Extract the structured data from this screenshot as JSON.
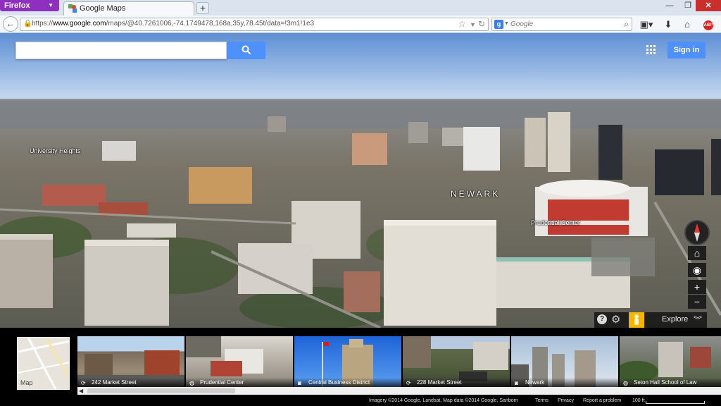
{
  "browser": {
    "app_button": "Firefox",
    "tab_title": "Google Maps",
    "url_domain": "www.google.com",
    "url_prefix": "https://",
    "url_path": "/maps/@40.7261006,-74.1749478,168a,35y,78.45t/data=!3m1!1e3",
    "search_placeholder": "Google"
  },
  "maps": {
    "signin_label": "Sign in",
    "labels": {
      "university_heights": "University Heights",
      "newark": "NEWARK",
      "prudential_center": "Prudential Center"
    },
    "explore_label": "Explore",
    "minimap_label": "Map",
    "photos": [
      {
        "caption": "242 Market Street",
        "icon": "panorama-icon"
      },
      {
        "caption": "Prudential Center",
        "icon": "globe-icon"
      },
      {
        "caption": "Central Business District",
        "icon": "camera-icon"
      },
      {
        "caption": "228 Market Street",
        "icon": "panorama-icon"
      },
      {
        "caption": "Newark",
        "icon": "camera-icon"
      },
      {
        "caption": "Seton Hall School of Law",
        "icon": "globe-icon"
      }
    ],
    "footer": {
      "imagery": "Imagery ©2014 Google, Landsat, Map data ©2014 Google, Sanborn",
      "terms": "Terms",
      "privacy": "Privacy",
      "report": "Report a problem",
      "scale": "100 ft"
    }
  },
  "colors": {
    "firefox_purple": "#8f2fbf",
    "google_blue": "#4d90fe",
    "close_red": "#c9302c",
    "pegman_yellow": "#f4b400"
  }
}
